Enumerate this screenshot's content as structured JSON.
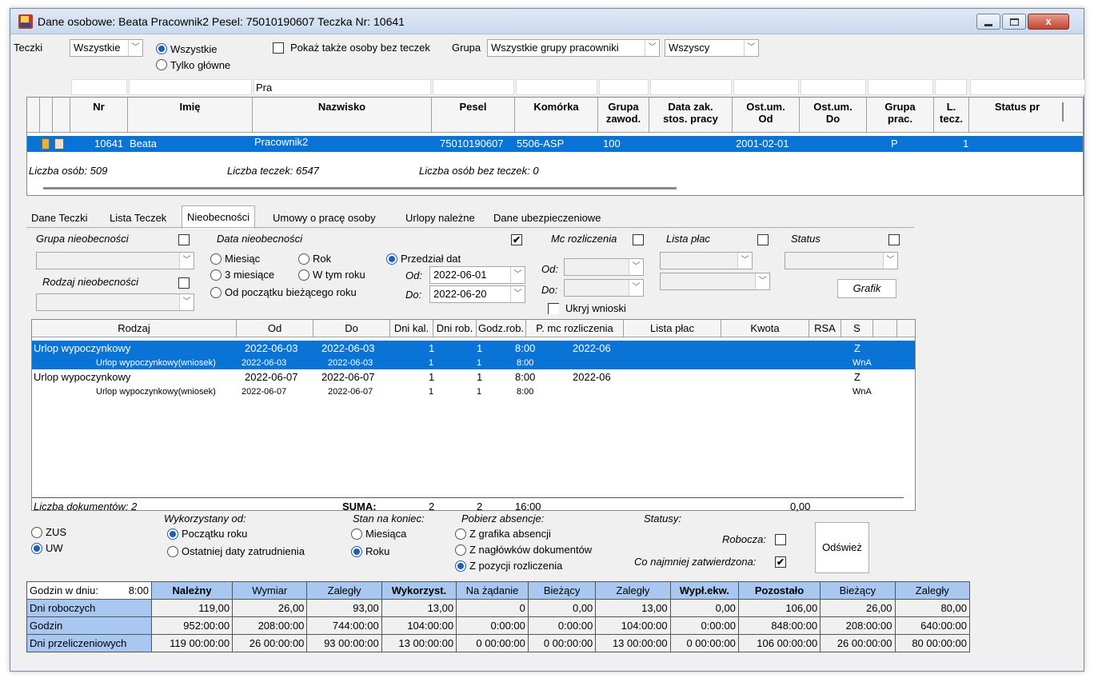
{
  "window": {
    "title": "Dane osobowe: Beata Pracownik2 Pesel: 75010190607 Teczka Nr: 10641",
    "close_label": "x"
  },
  "filters": {
    "teczki_label": "Teczki",
    "teczki_value": "Wszystkie",
    "radio_wszystkie": "Wszystkie",
    "radio_tylko": "Tylko główne",
    "pokaz_label": "Pokaż także osoby bez teczek",
    "grupa_label": "Grupa",
    "grupa_value": "Wszystkie grupy pracowniki",
    "wszyscy_value": "Wszyscy",
    "nazwisko_filter": "Pra"
  },
  "people_grid": {
    "headers": [
      "Nr",
      "Imię",
      "Nazwisko",
      "Pesel",
      "Komórka",
      "Grupa zawod.",
      "Data zak. stos. pracy",
      "Ost.um. Od",
      "Ost.um. Do",
      "Grupa prac.",
      "L. tecz.",
      "Status pr"
    ],
    "row": {
      "nr": "10641",
      "imie": "Beata",
      "nazwisko": "Pracownik2",
      "pesel": "75010190607",
      "komorka": "5506-ASP",
      "grupa_zawod": "100",
      "ost_od": "2001-02-01",
      "grupa_prac": "P",
      "l_tecz": "1"
    },
    "footer_osob": "Liczba osób: 509",
    "footer_teczek": "Liczba teczek: 6547",
    "footer_bez": "Liczba osób bez teczek: 0"
  },
  "tabs": [
    "Dane Teczki",
    "Lista Teczek",
    "Nieobecności",
    "Umowy o pracę osoby",
    "Urlopy należne",
    "Dane ubezpieczeniowe"
  ],
  "absence_filters": {
    "grupa_nieob": "Grupa nieobecności",
    "rodzaj_nieob": "Rodzaj nieobecności",
    "data_nieob": "Data nieobecności",
    "miesiac": "Miesiąc",
    "rok": "Rok",
    "przedzial": "Przedział dat",
    "trzy_mies": "3 miesiące",
    "w_tym_roku": "W tym roku",
    "od_poczatku": "Od początku bieżącego roku",
    "od_label": "Od:",
    "do_label": "Do:",
    "od_value": "2022-06-01",
    "do_value": "2022-06-20",
    "mc_rozl": "Mc rozliczenia",
    "mc_od": "Od:",
    "mc_do": "Do:",
    "lista_plac": "Lista płac",
    "status": "Status",
    "grafik": "Grafik",
    "ukryj": "Ukryj wnioski",
    "check_mark": "✔"
  },
  "absence_grid": {
    "headers": [
      "Rodzaj",
      "Od",
      "Do",
      "Dni kal.",
      "Dni rob.",
      "Godz.rob.",
      "P. mc rozliczenia",
      "Lista płac",
      "Kwota",
      "RSA",
      "S"
    ],
    "rows": [
      {
        "rodzaj": "Urlop wypoczynkowy",
        "od": "2022-06-03",
        "do": "2022-06-03",
        "kal": "1",
        "rob": "1",
        "godz": "8:00",
        "mc": "2022-06",
        "s": "Z"
      },
      {
        "rodzaj": "Urlop wypoczynkowy(wniosek)",
        "od": "2022-06-03",
        "do": "2022-06-03",
        "kal": "1",
        "rob": "1",
        "godz": "8:00",
        "mc": "",
        "s": "WnA"
      },
      {
        "rodzaj": "Urlop wypoczynkowy",
        "od": "2022-06-07",
        "do": "2022-06-07",
        "kal": "1",
        "rob": "1",
        "godz": "8:00",
        "mc": "2022-06",
        "s": "Z"
      },
      {
        "rodzaj": "Urlop wypoczynkowy(wniosek)",
        "od": "2022-06-07",
        "do": "2022-06-07",
        "kal": "1",
        "rob": "1",
        "godz": "8:00",
        "mc": "",
        "s": "WnA"
      }
    ],
    "footer_count": "Liczba dokumentów: 2",
    "suma_label": "SUMA:",
    "suma_kal": "2",
    "suma_rob": "2",
    "suma_godz": "16:00",
    "suma_kwota": "0,00"
  },
  "options": {
    "zus": "ZUS",
    "uw": "UW",
    "wykorzystany": "Wykorzystany od:",
    "poczatku_roku": "Początku roku",
    "ostatniej": "Ostatniej daty zatrudnienia",
    "stan": "Stan na koniec:",
    "miesiaca": "Miesiąca",
    "roku": "Roku",
    "pobierz": "Pobierz absencje:",
    "z_grafika": "Z grafika absencji",
    "z_naglowkow": "Z nagłówków dokumentów",
    "z_pozycji": "Z pozycji rozliczenia",
    "statusy": "Statusy:",
    "robocza": "Robocza:",
    "co_najmniej": "Co najmniej zatwierdzona:",
    "odswiez": "Odśwież"
  },
  "summary": {
    "godzin_label": "Godzin w dniu:",
    "godzin_value": "8:00",
    "headers": [
      "Należny",
      "Wymiar",
      "Zaległy",
      "Wykorzyst.",
      "Na żądanie",
      "Bieżący",
      "Zaległy",
      "Wypł.ekw.",
      "Pozostało",
      "Bieżący",
      "Zaległy"
    ],
    "rows": [
      {
        "label": "Dni roboczych",
        "values": [
          "119,00",
          "26,00",
          "93,00",
          "13,00",
          "0",
          "0,00",
          "13,00",
          "0,00",
          "106,00",
          "26,00",
          "80,00"
        ]
      },
      {
        "label": "Godzin",
        "values": [
          "952:00:00",
          "208:00:00",
          "744:00:00",
          "104:00:00",
          "0:00:00",
          "0:00:00",
          "104:00:00",
          "0:00:00",
          "848:00:00",
          "208:00:00",
          "640:00:00"
        ]
      },
      {
        "label": "Dni przeliczeniowych",
        "values": [
          "119 00:00:00",
          "26 00:00:00",
          "93 00:00:00",
          "13 00:00:00",
          "0 00:00:00",
          "0 00:00:00",
          "13 00:00:00",
          "0 00:00:00",
          "106 00:00:00",
          "26 00:00:00",
          "80 00:00:00"
        ]
      }
    ]
  }
}
